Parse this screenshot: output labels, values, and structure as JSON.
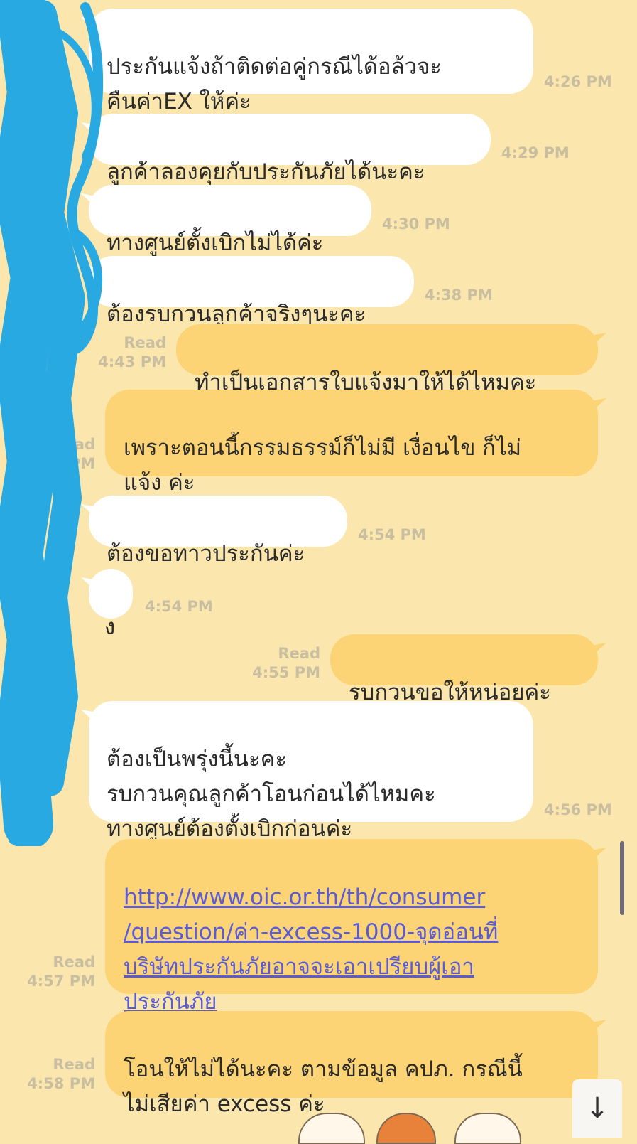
{
  "messages": [
    {
      "dir": "in",
      "text": "ประกันแจ้งถ้าติดต่อคู่กรณีได้อล้วจะ\nคืนค่าEX ให้ค่ะ",
      "time": "4:26 PM"
    },
    {
      "dir": "in",
      "text": "ลูกค้าลองคุยกับประกันภัยได้นะคะ",
      "time": "4:29 PM"
    },
    {
      "dir": "in",
      "text": "ทางศูนย์ตั้งเบิกไม่ได้ค่ะ",
      "time": "4:30 PM"
    },
    {
      "dir": "in",
      "text": "ต้องรบกวนลูกค้าจริงๆนะคะ",
      "time": "4:38 PM"
    },
    {
      "dir": "out",
      "text": "ทำเป็นเอกสารใบแจ้งมาให้ได้ไหมคะ",
      "read": "Read",
      "time": "4:43 PM"
    },
    {
      "dir": "out",
      "text": "เพราะตอนนี้กรรมธรรม์ก็ไม่มี เงื่อนไข ก็ไม่\nแจ้ง ค่ะ",
      "read": "Read",
      "time": "PM"
    },
    {
      "dir": "in",
      "text": "ต้องขอทาวประกันค่ะ",
      "time": "4:54 PM"
    },
    {
      "dir": "in",
      "text": "ง",
      "time": "4:54 PM"
    },
    {
      "dir": "out",
      "text": "รบกวนขอให้หน่อยค่ะ",
      "read": "Read",
      "time": "4:55 PM"
    },
    {
      "dir": "in",
      "text": "ต้องเป็นพรุ่งนี้นะคะ\nรบกวนคุณลูกค้าโอนก่อนได้ไหมคะ\nทางศูนย์ต้องตั้งเบิกก่อนค่ะ",
      "time": "4:56 PM"
    },
    {
      "dir": "out",
      "link": "http://www.oic.or.th/th/consumer\n/question/ค่า-excess-1000-จุดอ่อนที่\nบริษัทประกันภัยอาจจะเอาเปรียบผู้เอา\nประกันภัย",
      "read": "Read",
      "time": "4:57 PM"
    },
    {
      "dir": "out",
      "text": "โอนให้ไม่ได้นะคะ ตามข้อมูล คปภ. กรณีนี้\nไม่เสียค่า excess ค่ะ",
      "read": "Read",
      "time": "4:58 PM"
    }
  ],
  "scroll_down_icon": "arrow-down-icon",
  "colors": {
    "background": "#fbe7ae",
    "incoming_bubble": "#ffffff",
    "outgoing_bubble": "#fcd476",
    "timestamp": "#c9bea0",
    "link": "#5a5cd6",
    "redaction": "#29a9e1"
  }
}
